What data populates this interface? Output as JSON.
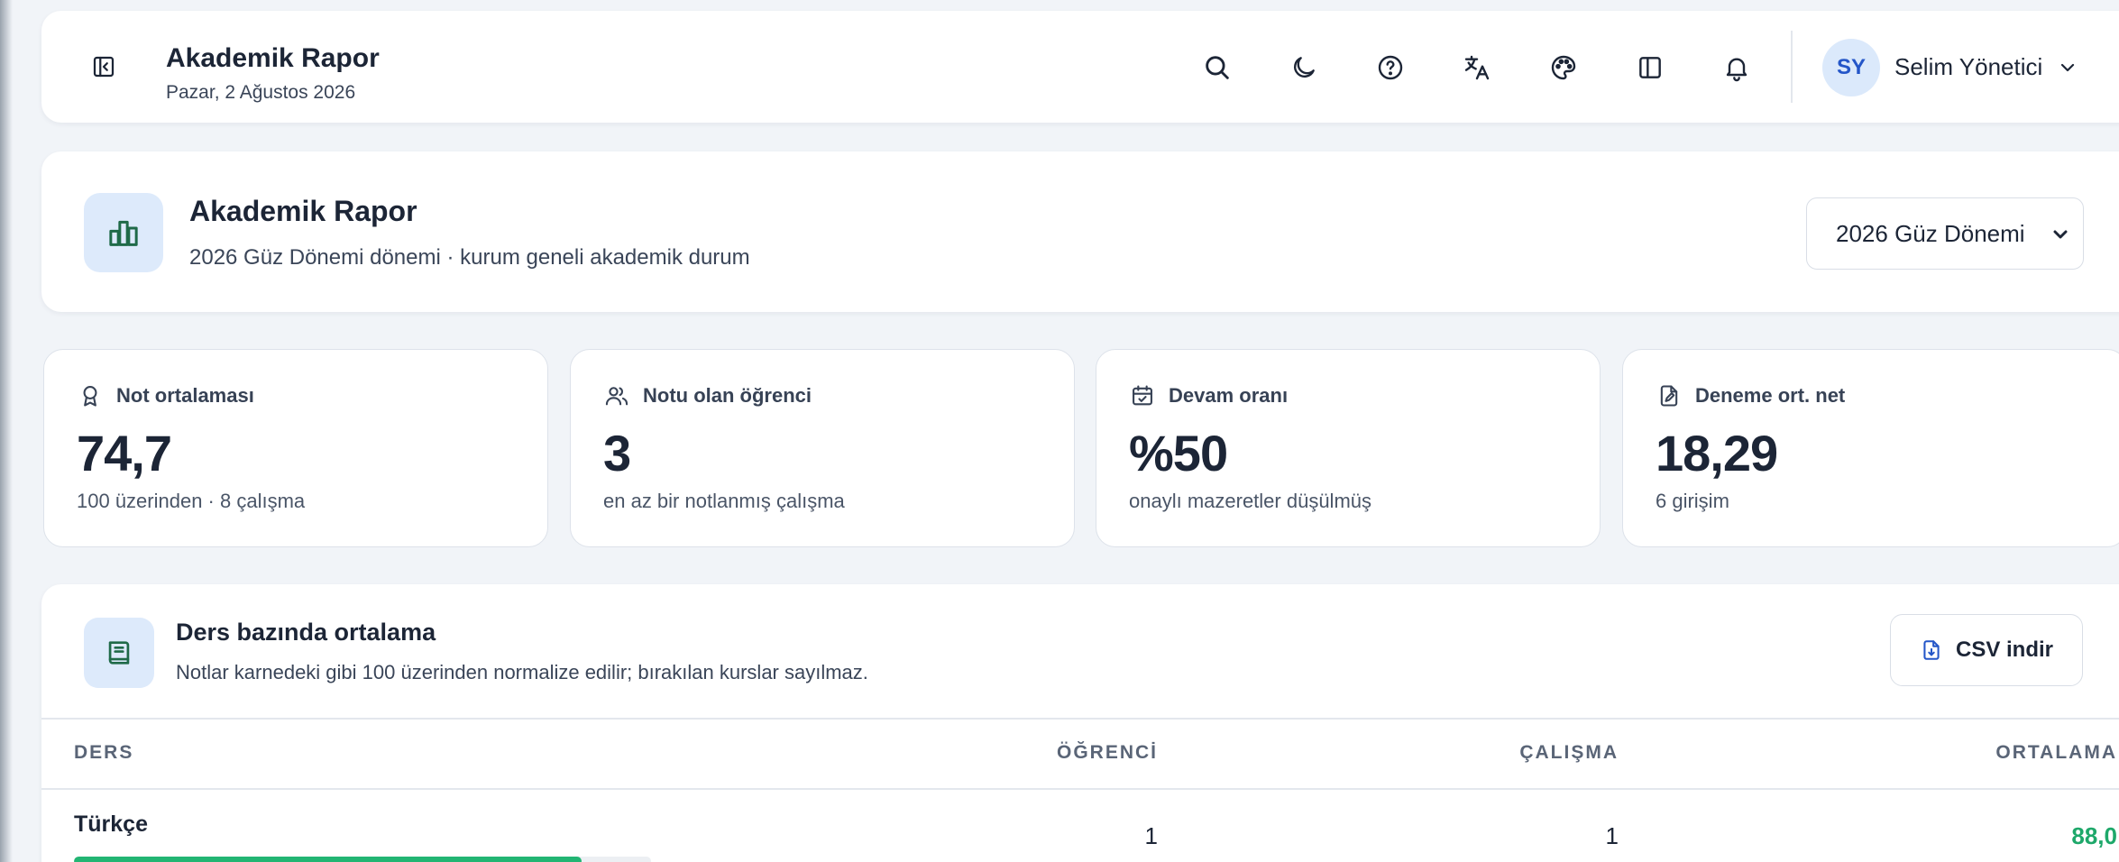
{
  "header": {
    "title": "Akademik Rapor",
    "date": "Pazar, 2 Ağustos 2026",
    "user_initials": "SY",
    "user_name": "Selim Yönetici"
  },
  "page": {
    "title": "Akademik Rapor",
    "subtitle": "2026 Güz Dönemi dönemi · kurum geneli akademik durum",
    "term_selected": "2026 Güz Dönemi"
  },
  "stats": [
    {
      "label": "Not ortalaması",
      "value": "74,7",
      "sub": "100 üzerinden · 8 çalışma",
      "icon": "award-icon"
    },
    {
      "label": "Notu olan öğrenci",
      "value": "3",
      "sub": "en az bir notlanmış çalışma",
      "icon": "users-icon"
    },
    {
      "label": "Devam oranı",
      "value": "%50",
      "sub": "onaylı mazeretler düşülmüş",
      "icon": "calendar-check-icon"
    },
    {
      "label": "Deneme ort. net",
      "value": "18,29",
      "sub": "6 girişim",
      "icon": "file-edit-icon"
    }
  ],
  "course_table": {
    "title": "Ders bazında ortalama",
    "subtitle": "Notlar karnedeki gibi 100 üzerinden normalize edilir; bırakılan kurslar sayılmaz.",
    "csv_label": "CSV indir",
    "columns": [
      "DERS",
      "ÖĞRENCİ",
      "ÇALIŞMA",
      "ORTALAMA"
    ],
    "rows": [
      {
        "course": "Türkçe",
        "students": "1",
        "works": "1",
        "average": "88,0",
        "average_fraction": 0.88
      }
    ]
  },
  "colors": {
    "accent": "#2456c8",
    "success": "#1ea86a",
    "background": "#f1f4f8"
  }
}
